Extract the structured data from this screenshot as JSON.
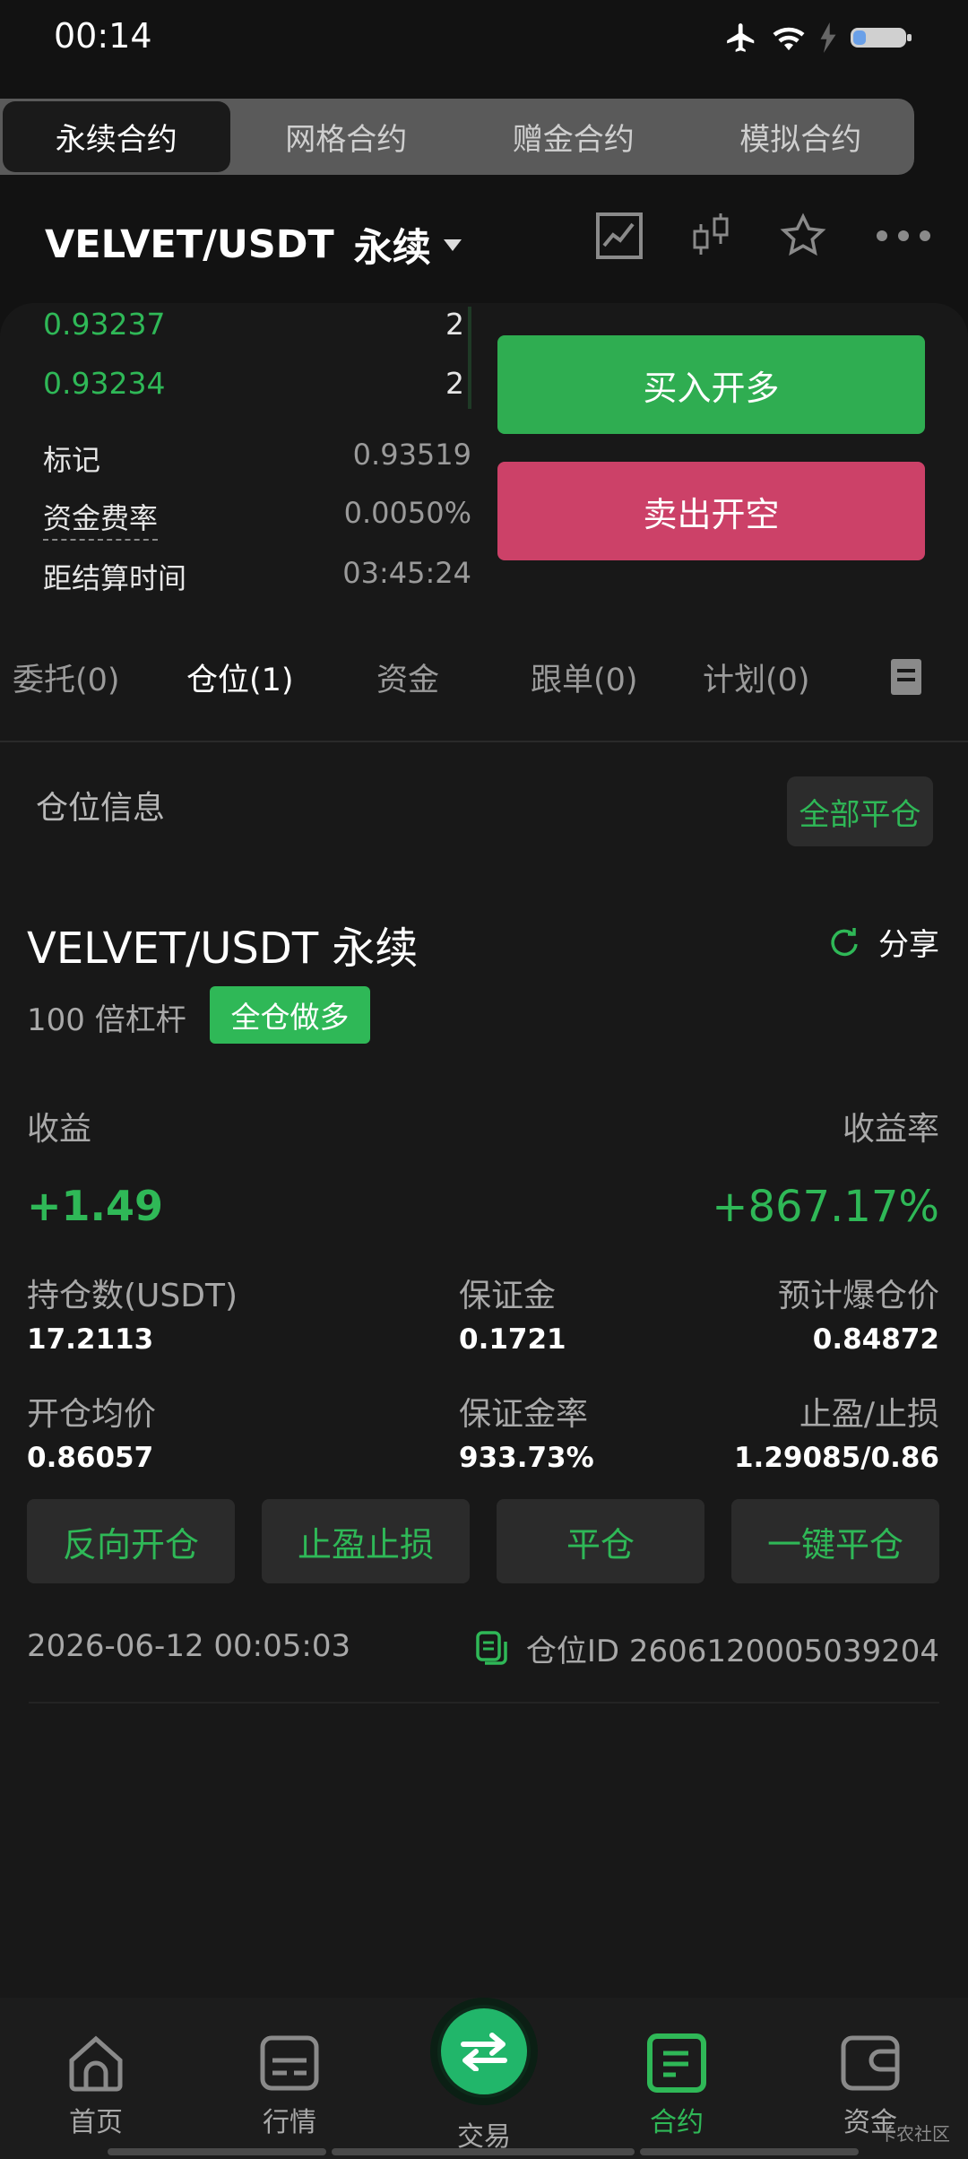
{
  "status": {
    "time": "00:14"
  },
  "segments": [
    {
      "label": "永续合约",
      "active": true
    },
    {
      "label": "网格合约"
    },
    {
      "label": "赠金合约"
    },
    {
      "label": "模拟合约"
    }
  ],
  "header": {
    "pair": "VELVET/USDT",
    "type": "永续"
  },
  "orderbook": [
    {
      "price": "0.93237",
      "qty": "2"
    },
    {
      "price": "0.93234",
      "qty": "2"
    }
  ],
  "market_info": {
    "mark_label": "标记",
    "mark_value": "0.93519",
    "funding_label": "资金费率",
    "funding_value": "0.0050%",
    "settle_label": "距结算时间",
    "settle_value": "03:45:24"
  },
  "trade": {
    "buy_label": "买入开多",
    "sell_label": "卖出开空"
  },
  "tabs": [
    "委托(0)",
    "仓位(1)",
    "资金",
    "跟单(0)",
    "计划(0)"
  ],
  "section": {
    "title": "仓位信息",
    "close_all": "全部平仓"
  },
  "position": {
    "title": "VELVET/USDT 永续",
    "share": "分享",
    "leverage": "100 倍杠杆",
    "badge": "全仓做多",
    "pnl_label": "收益",
    "pnl_value": "+1.49",
    "roi_label": "收益率",
    "roi_value": "+867.17%",
    "size_label": "持仓数(USDT)",
    "size_value": "17.2113",
    "margin_label": "保证金",
    "margin_value": "0.1721",
    "liq_label": "预计爆仓价",
    "liq_value": "0.84872",
    "entry_label": "开仓均价",
    "entry_value": "0.86057",
    "margin_ratio_label": "保证金率",
    "margin_ratio_value": "933.73%",
    "tpsl_label": "止盈/止损",
    "tpsl_value": "1.29085/0.86",
    "actions": [
      "反向开仓",
      "止盈止损",
      "平仓",
      "一键平仓"
    ],
    "timestamp": "2026-06-12 00:05:03",
    "id_text": "仓位ID 2606120005039204"
  },
  "nav": [
    "首页",
    "行情",
    "交易",
    "合约",
    "资金"
  ],
  "watermark": "卡农社区",
  "colors": {
    "green": "#2fb857",
    "red": "#d9436a",
    "bg": "#121212"
  }
}
